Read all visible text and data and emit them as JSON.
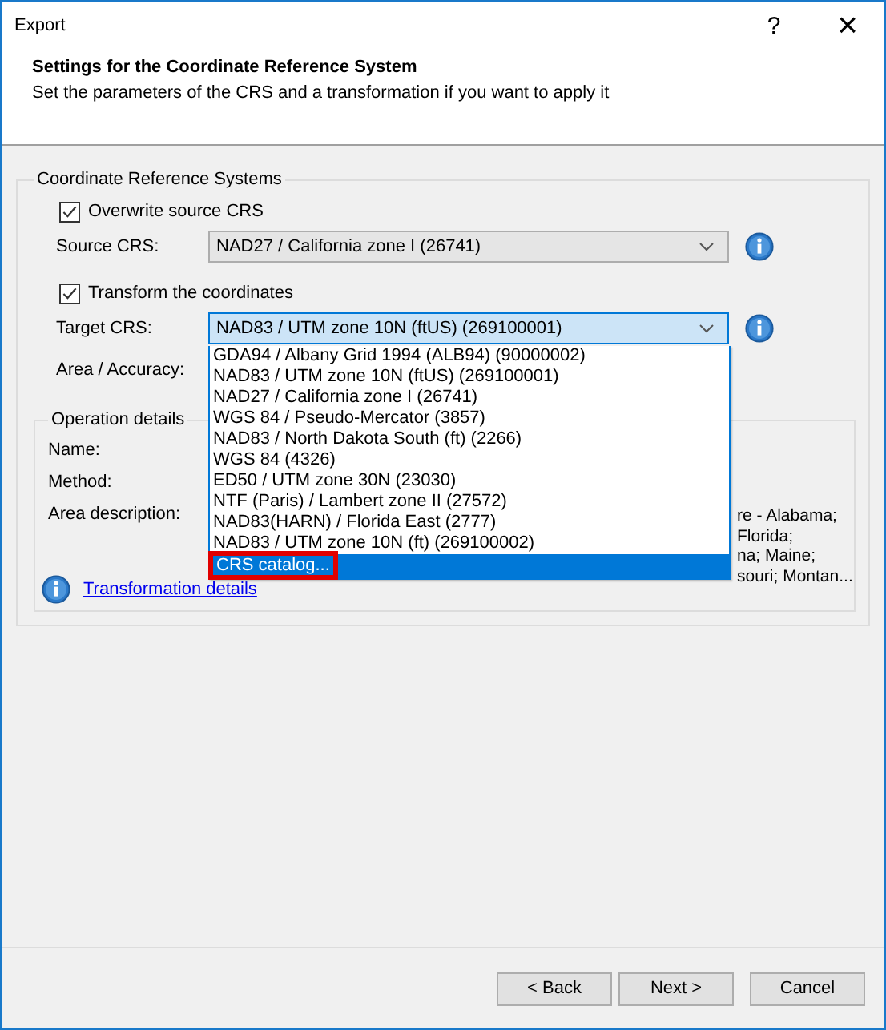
{
  "window": {
    "title": "Export",
    "help": "?",
    "close": "×"
  },
  "header": {
    "title": "Settings for the Coordinate Reference System",
    "subtitle": "Set the parameters of the CRS and a transformation if you want to apply it"
  },
  "group": {
    "title": "Coordinate Reference Systems",
    "overwrite": {
      "label": "Overwrite source CRS",
      "checked": true
    },
    "source": {
      "label": "Source CRS:",
      "value": "NAD27 / California zone I (26741)"
    },
    "transform": {
      "label": "Transform the coordinates",
      "checked": true
    },
    "target": {
      "label": "Target CRS:",
      "value": "NAD83 / UTM zone 10N (ftUS) (269100001)",
      "expanded": true
    },
    "area_label": "Area / Accuracy:",
    "operation": {
      "title": "Operation details",
      "name_label": "Name:",
      "method_label": "Method:",
      "area_label": "Area description:",
      "area_visible": [
        "re - Alabama;",
        "Florida;",
        "na; Maine;",
        "souri; Montan..."
      ]
    },
    "link": "Transformation details"
  },
  "dropdown": [
    {
      "label": "GDA94 / Albany Grid 1994 (ALB94)  (90000002)",
      "selected": false
    },
    {
      "label": "NAD83 / UTM zone 10N (ftUS) (269100001)",
      "selected": false
    },
    {
      "label": "NAD27 / California zone I (26741)",
      "selected": false
    },
    {
      "label": "WGS 84 / Pseudo-Mercator (3857)",
      "selected": false
    },
    {
      "label": "NAD83 / North Dakota South (ft) (2266)",
      "selected": false
    },
    {
      "label": "WGS 84 (4326)",
      "selected": false
    },
    {
      "label": "ED50 / UTM zone 30N (23030)",
      "selected": false
    },
    {
      "label": "NTF (Paris) / Lambert zone II (27572)",
      "selected": false
    },
    {
      "label": "NAD83(HARN) / Florida East (2777)",
      "selected": false
    },
    {
      "label": "NAD83 / UTM zone 10N (ft) (269100002)",
      "selected": false
    },
    {
      "label": "CRS catalog...",
      "selected": true,
      "highlighted": true
    }
  ],
  "buttons": [
    {
      "label": "< Back"
    },
    {
      "label": "Next >"
    },
    {
      "label": "Cancel"
    }
  ]
}
